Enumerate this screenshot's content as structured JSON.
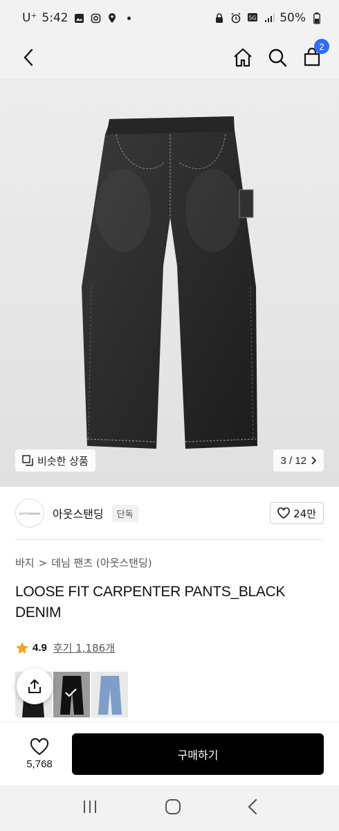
{
  "status_bar": {
    "carrier": "U⁺",
    "time": "5:42",
    "battery": "50%"
  },
  "header": {
    "cart_count": "2"
  },
  "gallery": {
    "similar_label": "비슷한 상품",
    "pager": "3 / 12"
  },
  "brand": {
    "logo_text": "OUTSTANDING",
    "name": "아웃스탠딩",
    "tag": "단독",
    "likes": "24만"
  },
  "breadcrumb": {
    "level1": "바지",
    "separator": ">",
    "level2": "데님 팬츠 (아웃스탠딩)"
  },
  "product": {
    "title": "LOOSE FIT CARPENTER PANTS_BLACK DENIM"
  },
  "rating": {
    "score": "4.9",
    "reviews": "후기 1,186개"
  },
  "bottom_bar": {
    "wish_count": "5,768",
    "buy_label": "구매하기"
  },
  "colors": {
    "accent": "#2f6df6",
    "star": "#f5a623",
    "buy_button": "#000000"
  },
  "icons": [
    "back-icon",
    "home-icon",
    "search-icon",
    "cart-icon",
    "similar-icon",
    "chevron-right-icon",
    "heart-icon",
    "star-icon",
    "share-icon",
    "recent-apps-icon",
    "home-nav-icon",
    "back-nav-icon"
  ]
}
